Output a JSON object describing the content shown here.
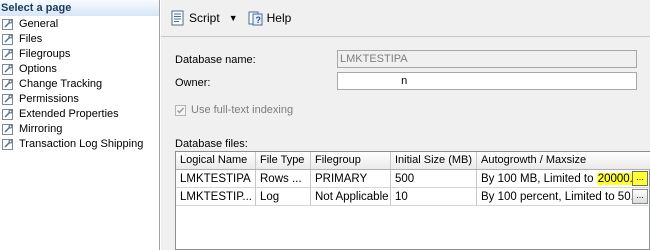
{
  "left_pane": {
    "header": "Select a page",
    "items": [
      {
        "label": "General"
      },
      {
        "label": "Files"
      },
      {
        "label": "Filegroups"
      },
      {
        "label": "Options"
      },
      {
        "label": "Change Tracking"
      },
      {
        "label": "Permissions"
      },
      {
        "label": "Extended Properties"
      },
      {
        "label": "Mirroring"
      },
      {
        "label": "Transaction Log Shipping"
      }
    ]
  },
  "toolbar": {
    "script_label": "Script",
    "help_label": "Help"
  },
  "form": {
    "database_name_label": "Database name:",
    "database_name_value": "LMKTESTIPA",
    "owner_label": "Owner:",
    "owner_value": "                    n",
    "fulltext_label": "Use full-text indexing",
    "fulltext_checked": true
  },
  "database_files": {
    "label": "Database files:",
    "columns": [
      "Logical Name",
      "File Type",
      "Filegroup",
      "Initial Size (MB)",
      "Autogrowth / Maxsize"
    ],
    "rows": [
      {
        "logical_name": "LMKTESTIPA",
        "file_type": "Rows ...",
        "filegroup": "PRIMARY",
        "initial_size": "500",
        "autogrowth_prefix": "By 100 MB, Limited to ",
        "autogrowth_highlight": "20000..."
      },
      {
        "logical_name": "LMKTESTIP...",
        "file_type": "Log",
        "filegroup": "Not Applicable",
        "initial_size": "10",
        "autogrowth_prefix": "By 100 percent, Limited to 50...",
        "autogrowth_highlight": ""
      }
    ],
    "ellipsis_label": "..."
  },
  "colors": {
    "highlight": "#ffff33",
    "header_text": "#1e395b"
  }
}
